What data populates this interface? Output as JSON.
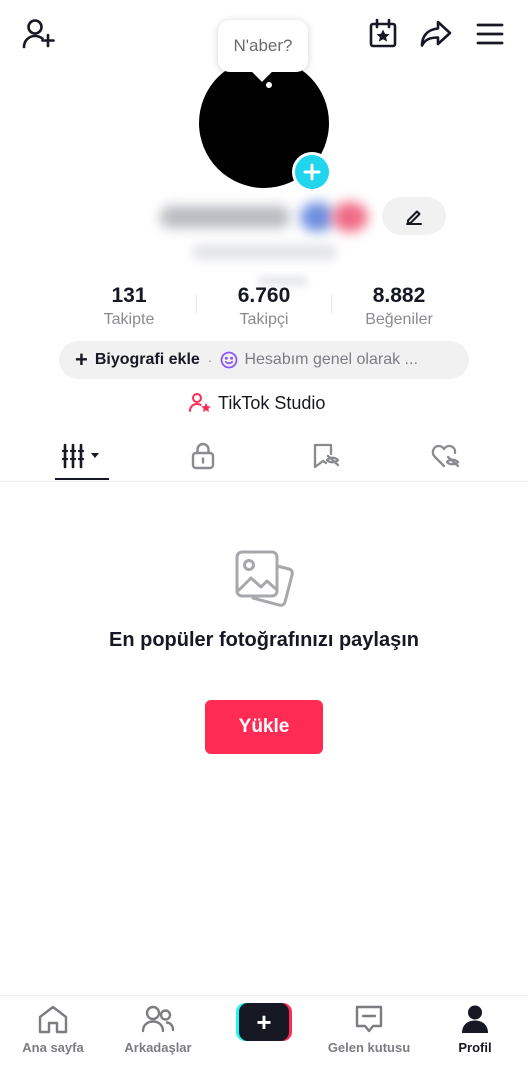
{
  "header": {
    "add_friend_icon": "person-add-icon",
    "calendar_icon": "calendar-star-icon",
    "share_icon": "share-arrow-icon",
    "menu_icon": "hamburger-menu-icon"
  },
  "status_bubble": {
    "text": "N'aber?"
  },
  "profile": {
    "edit_icon": "pencil-icon"
  },
  "stats": [
    {
      "value": "131",
      "label": "Takipte"
    },
    {
      "value": "6.760",
      "label": "Takipçi"
    },
    {
      "value": "8.882",
      "label": "Beğeniler"
    }
  ],
  "bio": {
    "add_label": "Biyografi ekle",
    "hint": "Hesabım genel olarak ..."
  },
  "studio": {
    "label": "TikTok Studio"
  },
  "tabs": [
    {
      "name": "videos-grid",
      "icon": "grid-sort-icon",
      "active": true
    },
    {
      "name": "private",
      "icon": "lock-icon"
    },
    {
      "name": "saved",
      "icon": "bookmark-hidden-icon"
    },
    {
      "name": "liked",
      "icon": "heart-hidden-icon"
    }
  ],
  "empty_state": {
    "title": "En popüler fotoğrafınızı paylaşın",
    "button_label": "Yükle"
  },
  "bottom_nav": [
    {
      "label": "Ana sayfa",
      "icon": "home-icon"
    },
    {
      "label": "Arkadaşlar",
      "icon": "friends-icon"
    },
    {
      "label": "",
      "icon": "create-plus-icon"
    },
    {
      "label": "Gelen kutusu",
      "icon": "inbox-icon"
    },
    {
      "label": "Profil",
      "icon": "profile-icon",
      "active": true
    }
  ],
  "colors": {
    "accent": "#fe2c55",
    "cyan": "#20d5ec",
    "text": "#161823",
    "muted": "#8a8b91"
  }
}
